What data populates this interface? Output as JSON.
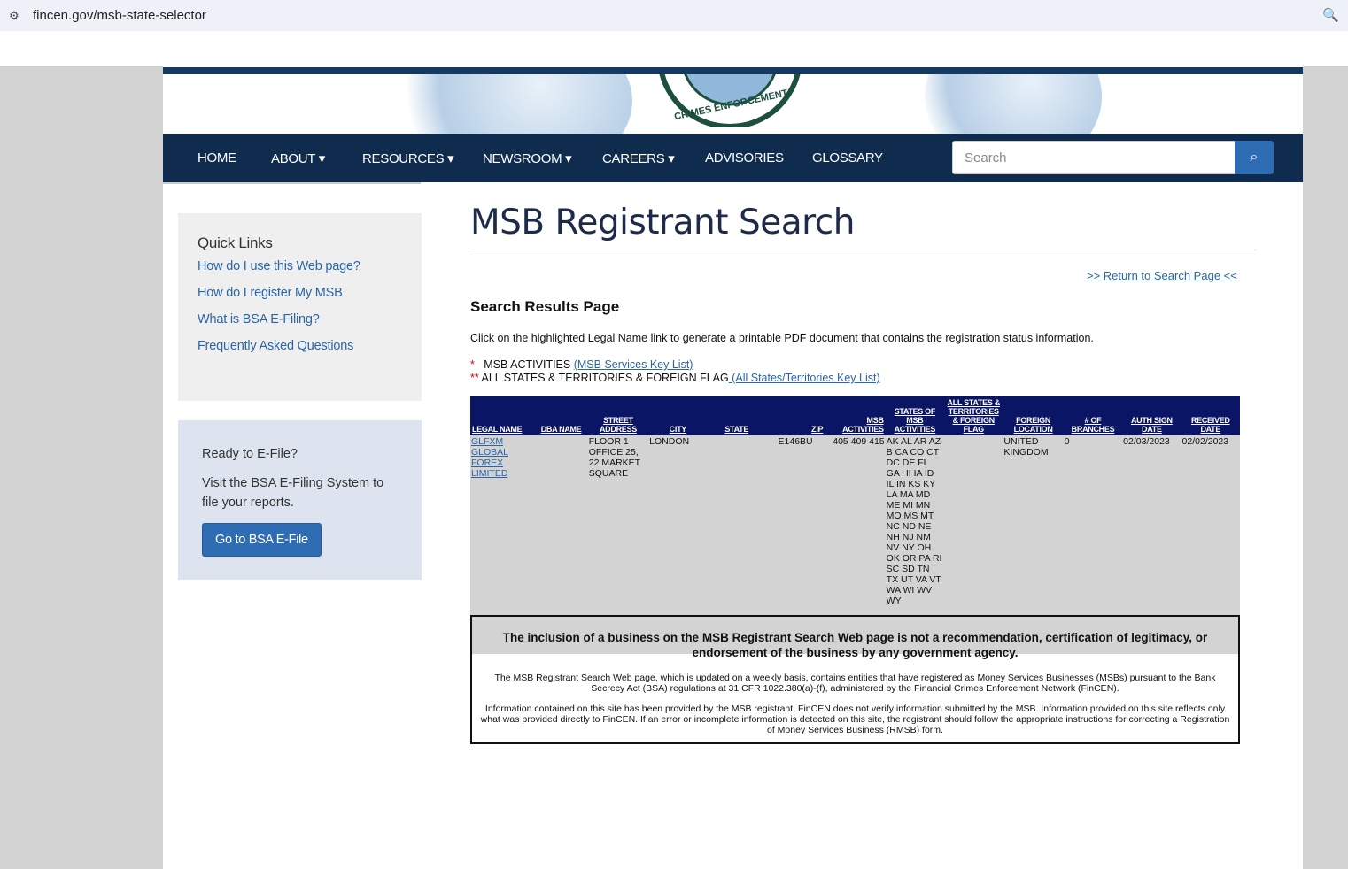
{
  "browser": {
    "url": "fincen.gov/msb-state-selector"
  },
  "banner": {
    "seal_text": "FINANCIAL CRIMES ENFORCEMENT NETWORK"
  },
  "nav": {
    "items": [
      {
        "label": "HOME"
      },
      {
        "label": "ABOUT ▾"
      },
      {
        "label": "RESOURCES ▾"
      },
      {
        "label": "NEWSROOM ▾"
      },
      {
        "label": "CAREERS ▾"
      },
      {
        "label": "ADVISORIES"
      },
      {
        "label": "GLOSSARY"
      }
    ],
    "search_placeholder": "Search"
  },
  "sidebar": {
    "quick_links_title": "Quick Links",
    "links": [
      "How do I use this Web page?",
      "How do I register My MSB",
      "What is BSA E-Filing?",
      "Frequently Asked Questions"
    ],
    "efile": {
      "title": "Ready to E-File?",
      "text": "Visit the BSA E-Filing System to file your reports.",
      "button": "Go to BSA E-File"
    }
  },
  "main": {
    "title": "MSB Registrant Search",
    "return_link": ">> Return to Search Page <<",
    "subtitle": "Search Results Page",
    "instruction": "Click on the highlighted Legal Name link to generate a printable PDF document that contains the registration status information.",
    "key1_mark": "*",
    "key1_text": "MSB ACTIVITIES ",
    "key1_link": "(MSB Services Key List)",
    "key2_mark": "**",
    "key2_text": " ALL STATES & TERRITORIES & FOREIGN FLAG",
    "key2_link": " (All States/Territories Key List)"
  },
  "table": {
    "headers": [
      "LEGAL NAME",
      "DBA NAME",
      "STREET ADDRESS",
      "CITY",
      "STATE",
      "ZIP",
      "MSB ACTIVITIES",
      "STATES OF MSB ACTIVITIES",
      "ALL STATES & TERRITORIES & FOREIGN FLAG",
      "FOREIGN LOCATION",
      "# OF BRANCHES",
      "AUTH SIGN DATE",
      "RECEIVED DATE"
    ],
    "row": {
      "legal_name": "GLFXM GLOBAL FOREX LIMITED",
      "dba_name": "",
      "street": "FLOOR 1 OFFICE 25, 22 MARKET SQUARE",
      "city": "LONDON",
      "state": "",
      "zip": "E146BU",
      "msb_activities": "405 409 415",
      "states": "AK AL AR AZ B CA CO CT DC DE FL GA HI IA ID IL IN KS KY LA MA MD ME MI MN MO MS MT NC ND NE NH NJ NM NV NY OH OK OR PA RI SC SD TN TX UT VA VT WA WI WV WY",
      "all_states_flag": "",
      "foreign_location": "UNITED KINGDOM",
      "branches": "0",
      "auth_sign_date": "02/03/2023",
      "received_date": "02/02/2023"
    }
  },
  "disclaimer": {
    "bold": "The inclusion of a business on the MSB Registrant Search Web page is not a recommendation, certification of legitimacy, or endorsement of the business by any government agency.",
    "p1": "The MSB Registrant Search Web page, which is updated on a weekly basis, contains entities that have registered as Money Services Businesses (MSBs) pursuant to the Bank Secrecy Act (BSA) regulations at 31 CFR 1022.380(a)-(f), administered by the Financial Crimes Enforcement Network (FinCEN).",
    "p2": "Information contained on this site has been provided by the MSB registrant. FinCEN does not verify information submitted by the MSB. Information provided on this site reflects only what was provided directly to FinCEN. If an error or incomplete information is detected on this site, the registrant should follow the appropriate instructions for correcting a Registration of Money Services Business (RMSB) form."
  }
}
